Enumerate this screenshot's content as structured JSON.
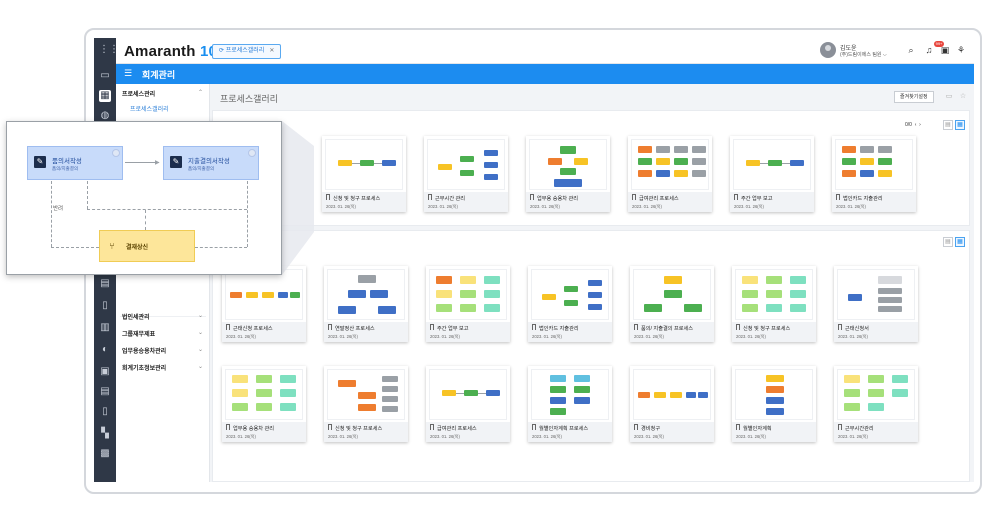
{
  "app": {
    "logo_text": "Amaranth",
    "logo_accent": "10",
    "brand_color": "#1c8cf0"
  },
  "topbar": {
    "open_tab": "프로세스갤러리",
    "user_name": "김도윤",
    "user_company": "(주)드림이에스 팀원",
    "notification_count": "99+"
  },
  "bluebar": {
    "title": "회계관리"
  },
  "sidebar": {
    "sections": [
      {
        "label": "프로세스관리",
        "expanded": true,
        "items": [
          "프로세스갤러리"
        ]
      },
      {
        "label": "법인세관리"
      },
      {
        "label": "그룹재무제표"
      },
      {
        "label": "업무용승용차관리"
      },
      {
        "label": "회계기초정보관리"
      }
    ]
  },
  "main": {
    "title": "프로세스갤러리",
    "favorite_button": "즐겨찾기설정",
    "pager": "0/0"
  },
  "row1": [
    {
      "title": "신청 및 청구 프로세스",
      "date": "2023. 01. 26(목)"
    },
    {
      "title": "근무시간 관리",
      "date": "2023. 01. 26(목)"
    },
    {
      "title": "업무용 승용차 관리",
      "date": "2023. 01. 26(목)"
    },
    {
      "title": "급여관리 프로세스",
      "date": "2023. 01. 26(목)"
    },
    {
      "title": "주간 업무 보고",
      "date": "2023. 01. 26(목)"
    },
    {
      "title": "법인카드 지출관리",
      "date": "2023. 01. 26(목)"
    }
  ],
  "row2": [
    {
      "title": "근태신청 프로세스",
      "date": "2023. 01. 26(목)"
    },
    {
      "title": "연말정산 프로세스",
      "date": "2023. 01. 26(목)"
    },
    {
      "title": "주간 업무 보고",
      "date": "2023. 01. 26(목)"
    },
    {
      "title": "법인카드 지출관리",
      "date": "2023. 01. 26(목)"
    },
    {
      "title": "품의/ 지출결의 프로세스",
      "date": "2023. 01. 26(목)"
    },
    {
      "title": "신청 및 청구 프로세스",
      "date": "2023. 01. 26(목)"
    },
    {
      "title": "근태신청서",
      "date": "2023. 01. 26(목)"
    }
  ],
  "row3": [
    {
      "title": "업무용 승용차 관리",
      "date": "2023. 01. 26(목)"
    },
    {
      "title": "신청 및 청구 프로세스",
      "date": "2023. 01. 26(목)"
    },
    {
      "title": "급여관리 프로세스",
      "date": "2023. 01. 26(목)"
    },
    {
      "title": "월별인자계획 프로세스",
      "date": "2023. 01. 26(목)"
    },
    {
      "title": "경비청구",
      "date": "2023. 01. 26(목)"
    },
    {
      "title": "월별인자계획",
      "date": "2023. 01. 26(목)"
    },
    {
      "title": "근무시간관리",
      "date": "2023. 01. 26(목)"
    }
  ],
  "callout": {
    "node1_title": "품의서작성",
    "node1_sub": "품의/지출결의",
    "node2_title": "지출결의서작성",
    "node2_sub": "품의/지출결의",
    "return_label": "반려",
    "node3_title": "결재상신"
  }
}
